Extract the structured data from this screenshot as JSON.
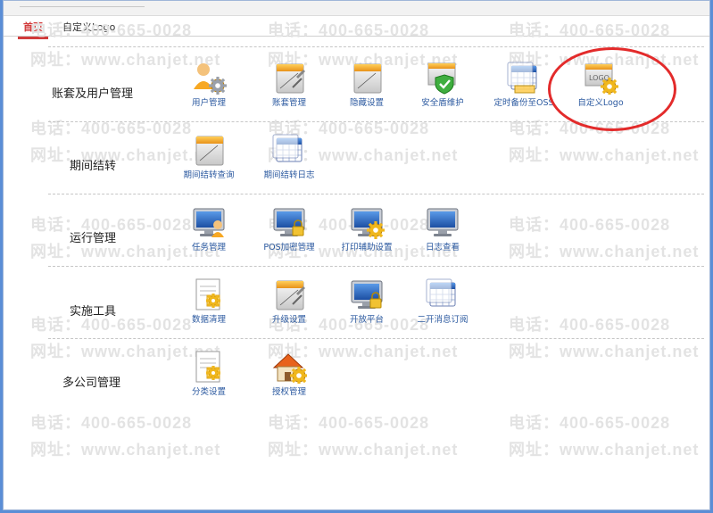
{
  "tabs": [
    "首页",
    "自定义Logo"
  ],
  "watermark": {
    "phone": "电话：400-665-0028",
    "url": "网址：www.chanjet.net"
  },
  "sections": [
    {
      "label": "账套及用户管理",
      "items": [
        {
          "label": "用户管理",
          "icon": "users-gear-icon"
        },
        {
          "label": "账套管理",
          "icon": "notebook-tools-icon"
        },
        {
          "label": "隐藏设置",
          "icon": "notebook-icon"
        },
        {
          "label": "安全盾维护",
          "icon": "shield-check-icon"
        },
        {
          "label": "定时备份至OSS",
          "icon": "calendar-backup-icon"
        },
        {
          "label": "自定义Logo",
          "icon": "logo-gear-icon"
        }
      ]
    },
    {
      "label": "期间结转",
      "items": [
        {
          "label": "期间结转查询",
          "icon": "notebook-icon"
        },
        {
          "label": "期间结转日志",
          "icon": "calendar-log-icon"
        }
      ]
    },
    {
      "label": "运行管理",
      "items": [
        {
          "label": "任务管理",
          "icon": "monitor-user-icon"
        },
        {
          "label": "POS加密管理",
          "icon": "monitor-lock-icon"
        },
        {
          "label": "打印辅助设置",
          "icon": "monitor-gear-icon"
        },
        {
          "label": "日志查看",
          "icon": "monitor-icon"
        }
      ]
    },
    {
      "label": "实施工具",
      "items": [
        {
          "label": "数据清理",
          "icon": "document-gear-icon"
        },
        {
          "label": "升级设置",
          "icon": "notebook-tools-icon"
        },
        {
          "label": "开放平台",
          "icon": "monitor-lock-icon"
        },
        {
          "label": "二开消息订阅",
          "icon": "calendar-log-icon"
        }
      ]
    },
    {
      "label": "多公司管理",
      "items": [
        {
          "label": "分类设置",
          "icon": "document-gear-icon"
        },
        {
          "label": "授权管理",
          "icon": "house-gear-icon"
        }
      ]
    }
  ],
  "colors": {
    "accent": "#d13b3b",
    "link": "#2c5aa0",
    "highlight_circle": "#e32b2b"
  }
}
